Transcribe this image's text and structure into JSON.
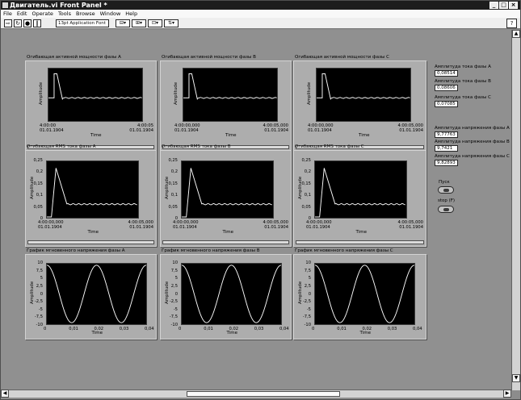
{
  "window": {
    "title": "Двигатель.vi Front Panel *"
  },
  "menu": [
    "File",
    "Edit",
    "Operate",
    "Tools",
    "Browse",
    "Window",
    "Help"
  ],
  "toolbar": {
    "font": "13pt Application Font"
  },
  "graphs": [
    {
      "caption": "Огибающая активной мощности фазы A",
      "ylabel": "Amplitude",
      "xlabel": "Time",
      "yticks": [],
      "x_start": [
        "4:00:00",
        "01.01.1904"
      ],
      "x_end": [
        "4:00:05",
        "01.01.1904"
      ],
      "kind": "step"
    },
    {
      "caption": "Огибающая активной мощности фазы B",
      "ylabel": "Amplitude",
      "xlabel": "Time",
      "yticks": [],
      "x_start": [
        "4:00:00,000",
        "01.01.1904"
      ],
      "x_end": [
        "4:00:05,000",
        "01.01.1904"
      ],
      "kind": "step"
    },
    {
      "caption": "Огибающая активной мощности фазы C",
      "ylabel": "Amplitude",
      "xlabel": "Time",
      "yticks": [],
      "x_start": [
        "4:00:00,000",
        "01.01.1904"
      ],
      "x_end": [
        "4:00:05,000",
        "01.01.1904"
      ],
      "kind": "step"
    },
    {
      "caption": "Огибающая RMS тока фазы A",
      "ylabel": "Amplitude",
      "xlabel": "Time",
      "yticks": [
        "0,25",
        "0,2",
        "0,15",
        "0,1",
        "0,05",
        "0"
      ],
      "x_start": [
        "4:00:00,000",
        "01.01.1904"
      ],
      "x_end": [
        "4:00:05,000",
        "01.01.1904"
      ],
      "kind": "rms"
    },
    {
      "caption": "Огибающая RMS тока фазы B",
      "ylabel": "Amplitude",
      "xlabel": "Time",
      "yticks": [
        "0,25",
        "0,2",
        "0,15",
        "0,1",
        "0,05",
        "0"
      ],
      "x_start": [
        "4:00:00,000",
        "01.01.1904"
      ],
      "x_end": [
        "4:00:05,000",
        "01.01.1904"
      ],
      "kind": "rms"
    },
    {
      "caption": "Огибающая RMS тока фазы C",
      "ylabel": "Amplitude",
      "xlabel": "Time",
      "yticks": [
        "0,25",
        "0,2",
        "0,15",
        "0,1",
        "0,05",
        "0"
      ],
      "x_start": [
        "4:00:00,000",
        "01.01.1904"
      ],
      "x_end": [
        "4:00:05,000",
        "01.01.1904"
      ],
      "kind": "rms"
    },
    {
      "caption": "График мгновенного напряжения фазы A",
      "ylabel": "Amplitude",
      "xlabel": "Time",
      "yticks": [
        "10",
        "7,5",
        "5",
        "2,5",
        "0",
        "-2,5",
        "-5",
        "-7,5",
        "-10"
      ],
      "xticks": [
        "0",
        "0,01",
        "0,02",
        "0,03",
        "0,04"
      ],
      "kind": "sine"
    },
    {
      "caption": "График мгновенного напряжения фазы B",
      "ylabel": "Amplitude",
      "xlabel": "Time",
      "yticks": [
        "10",
        "7,5",
        "5",
        "2,5",
        "0",
        "-2,5",
        "-5",
        "-7,5",
        "-10"
      ],
      "xticks": [
        "0",
        "0,01",
        "0,02",
        "0,03",
        "0,04"
      ],
      "kind": "sine"
    },
    {
      "caption": "График мгновенного напряжения фазы C",
      "ylabel": "Amplitude",
      "xlabel": "Time",
      "yticks": [
        "10",
        "7,5",
        "5",
        "2,5",
        "0",
        "-2,5",
        "-5",
        "-7,5",
        "-10"
      ],
      "xticks": [
        "0",
        "0,01",
        "0,02",
        "0,03",
        "0,04"
      ],
      "kind": "sine"
    }
  ],
  "indicators": [
    {
      "label": "Амплитуда тока фазы A",
      "value": "0,08514"
    },
    {
      "label": "Амплитуда тока фазы B",
      "value": "0,08606"
    },
    {
      "label": "Амплитуда тока фазы C",
      "value": "0,07085"
    },
    {
      "label": "Амплитуда напряжения фазы A",
      "value": "9,77763"
    },
    {
      "label": "Амплитуда напряжения фазы B",
      "value": "9,7421"
    },
    {
      "label": "Амплитуда напряжения фазы C",
      "value": "9,82893"
    }
  ],
  "buttons": {
    "pusk": "Пуск",
    "stop": "stop (F)"
  },
  "sine": {
    "amplitude": 10,
    "frequency_hz": 50,
    "x_range": [
      0,
      0.04
    ]
  },
  "rms": {
    "peak": 0.22,
    "steady": 0.06,
    "y_range": [
      0,
      0.25
    ]
  }
}
